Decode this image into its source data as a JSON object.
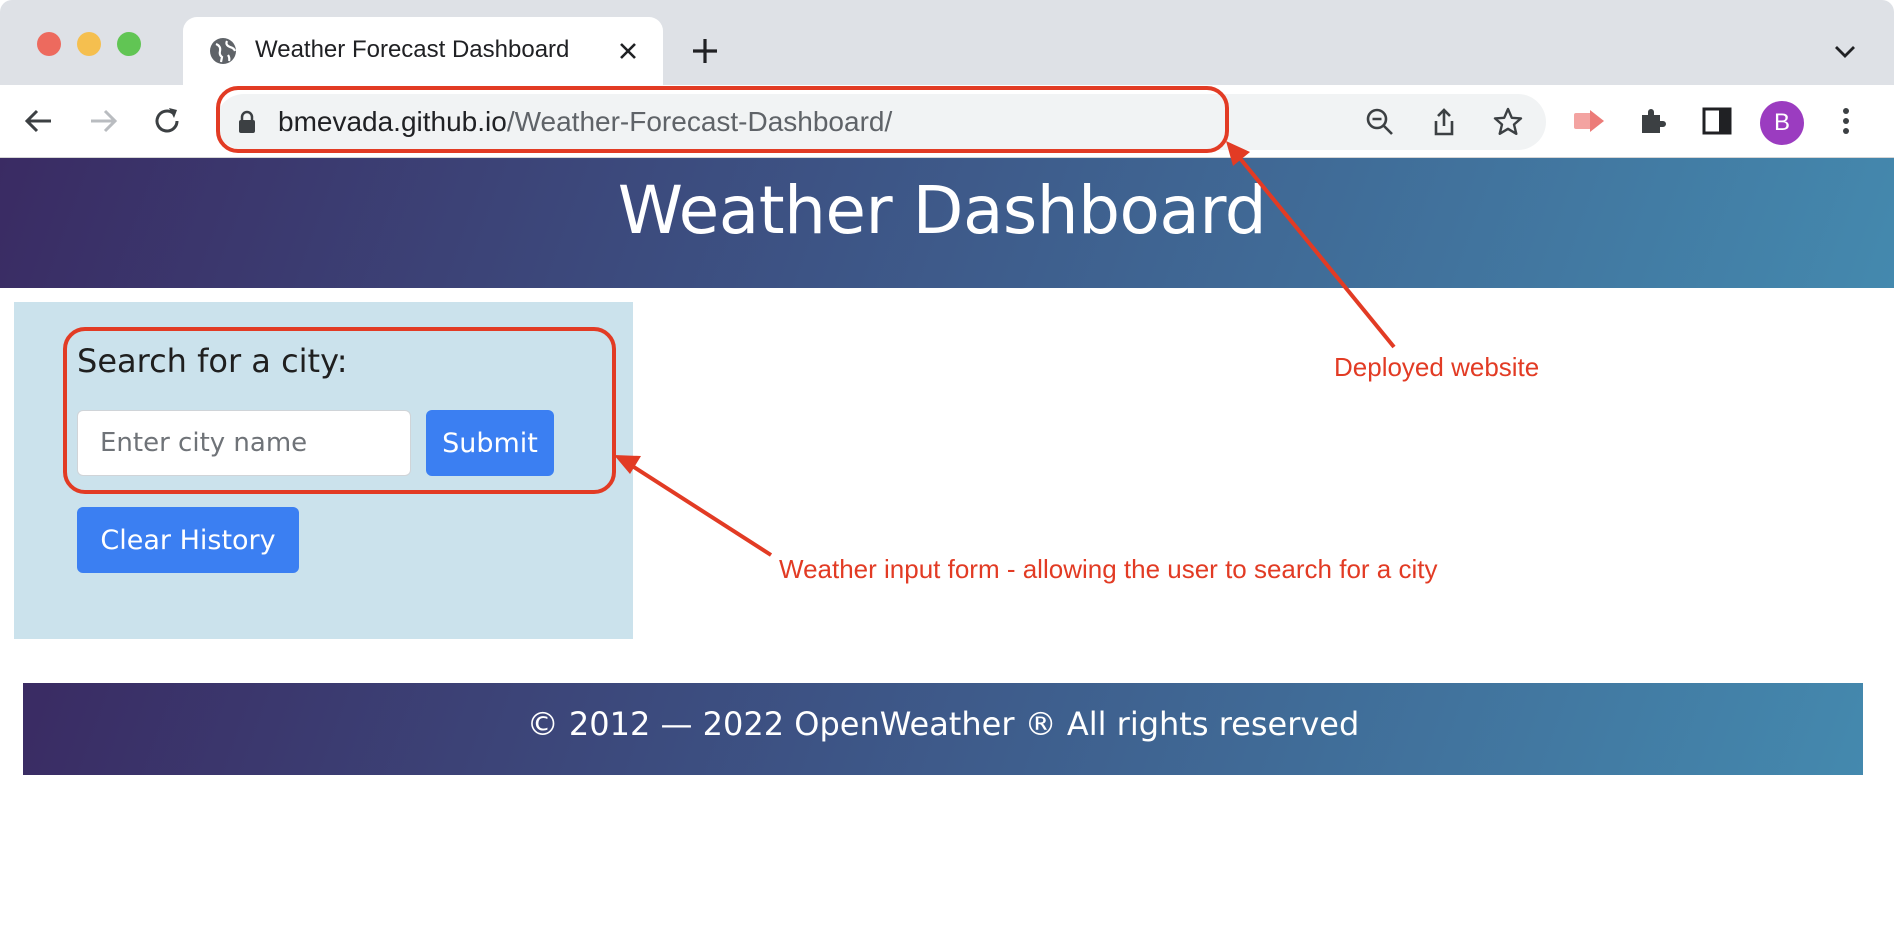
{
  "browser": {
    "tab_title": "Weather Forecast Dashboard",
    "url_host": "bmevada.github.io",
    "url_path": "/Weather-Forecast-Dashboard/",
    "profile_initial": "B"
  },
  "page": {
    "title": "Weather Dashboard",
    "search_label": "Search for a city:",
    "search_placeholder": "Enter city name",
    "submit_label": "Submit",
    "clear_label": "Clear History",
    "footer_text": "© 2012 — 2022 OpenWeather ® All rights reserved"
  },
  "annotations": {
    "deployed": "Deployed website",
    "form": "Weather input form - allowing the user to search for a city",
    "color": "#e23b24"
  },
  "colors": {
    "accent_button": "#3b7ff2",
    "panel_bg": "#cbe2ec",
    "header_gradient_start": "#3a2b63",
    "header_gradient_end": "#4489ae"
  }
}
